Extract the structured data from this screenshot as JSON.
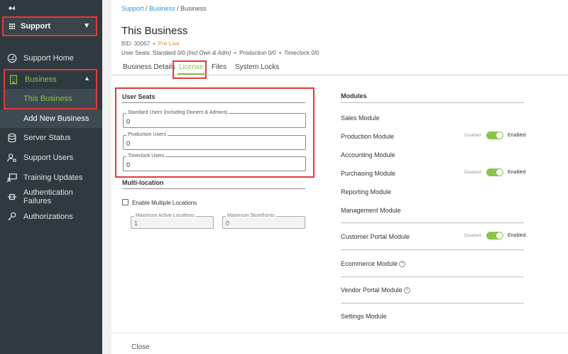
{
  "sidebar": {
    "collapse_icon": "↤",
    "app_selector": "Support",
    "items": [
      {
        "label": "Support Home",
        "icon": "gauge-icon"
      },
      {
        "label": "Business",
        "icon": "building-icon"
      },
      {
        "label": "This Business"
      },
      {
        "label": "Add New Business"
      },
      {
        "label": "Server Status",
        "icon": "database-icon"
      },
      {
        "label": "Support Users",
        "icon": "user-gear-icon"
      },
      {
        "label": "Training Updates",
        "icon": "presentation-icon"
      },
      {
        "label": "Authentication Failures",
        "icon": "plug-icon"
      },
      {
        "label": "Authorizations",
        "icon": "key-icon"
      }
    ]
  },
  "header": {
    "breadcrumb": {
      "support": "Support",
      "sep1": " / ",
      "business_link": "Business",
      "sep2": " / ",
      "current": "Business"
    },
    "title": "This Business",
    "bid": "BID: 30067",
    "dot": "•",
    "status": "Pre-Live",
    "seats_label": "User Seats: Standard 0/0",
    "seats_note": "(Incl Own & Adm)",
    "production": "Production 0/0",
    "timeclock": "Timeclock 0/0"
  },
  "tabs": [
    "Business Details",
    "License",
    "Files",
    "System Locks"
  ],
  "user_seats": {
    "title": "User Seats",
    "fields": [
      {
        "label": "Standard Users (including Owners & Admins)",
        "value": "0"
      },
      {
        "label": "Production Users",
        "value": "0"
      },
      {
        "label": "Timeclock Users",
        "value": "0"
      }
    ]
  },
  "multi_location": {
    "title": "Multi-location",
    "checkbox_label": "Enable Multiple Locations",
    "max_locations_label": "Maximum Active Locations",
    "max_locations_value": "1",
    "max_storefronts_label": "Maximum Storefronts",
    "max_storefronts_value": "0"
  },
  "modules": {
    "title": "Modules",
    "disabled_text": "Disabled",
    "enabled_text": "Enabled",
    "items": [
      "Sales Module",
      "Production Module",
      "Accounting Module",
      "Purchasing Module",
      "Reporting Module",
      "Management Module",
      "Customer Portal Module",
      "Ecommerce Module",
      "Vendor Portal Module",
      "Settings Module"
    ]
  },
  "footer": {
    "close": "Close"
  },
  "colors": {
    "accent": "#8bc34a",
    "sidebar": "#2f3a40",
    "link": "#2f8fd0",
    "warning": "#f08a24",
    "highlight": "#e03a3a"
  }
}
